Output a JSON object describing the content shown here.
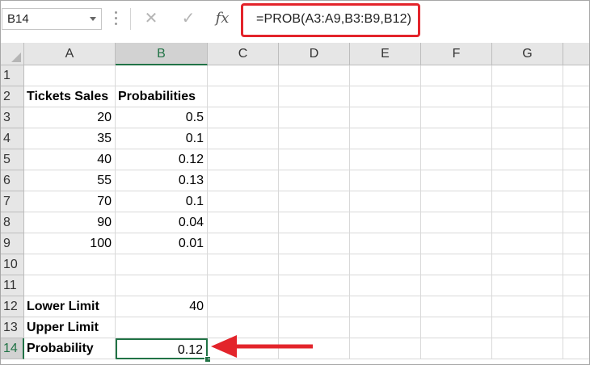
{
  "name_box": {
    "value": "B14"
  },
  "formula_bar": {
    "formula": "=PROB(A3:A9,B3:B9,B12)",
    "cancel_icon": "cancel-x-icon",
    "enter_icon": "checkmark-icon",
    "fx_label": "fx"
  },
  "columns": [
    "A",
    "B",
    "C",
    "D",
    "E",
    "F",
    "G"
  ],
  "active_column": "B",
  "active_row": "14",
  "rows": [
    {
      "num": "1",
      "a": "",
      "b": ""
    },
    {
      "num": "2",
      "a": "Tickets Sales",
      "b": "Probabilities"
    },
    {
      "num": "3",
      "a": "20",
      "b": "0.5"
    },
    {
      "num": "4",
      "a": "35",
      "b": "0.1"
    },
    {
      "num": "5",
      "a": "40",
      "b": "0.12"
    },
    {
      "num": "6",
      "a": "55",
      "b": "0.13"
    },
    {
      "num": "7",
      "a": "70",
      "b": "0.1"
    },
    {
      "num": "8",
      "a": "90",
      "b": "0.04"
    },
    {
      "num": "9",
      "a": "100",
      "b": "0.01"
    },
    {
      "num": "10",
      "a": "",
      "b": ""
    },
    {
      "num": "11",
      "a": "",
      "b": ""
    },
    {
      "num": "12",
      "a": "Lower Limit",
      "b": "40"
    },
    {
      "num": "13",
      "a": "Upper Limit",
      "b": ""
    },
    {
      "num": "14",
      "a": "Probability",
      "b": "0.12"
    }
  ],
  "colors": {
    "accent_green": "#217346",
    "highlight_red": "#e3242b"
  }
}
